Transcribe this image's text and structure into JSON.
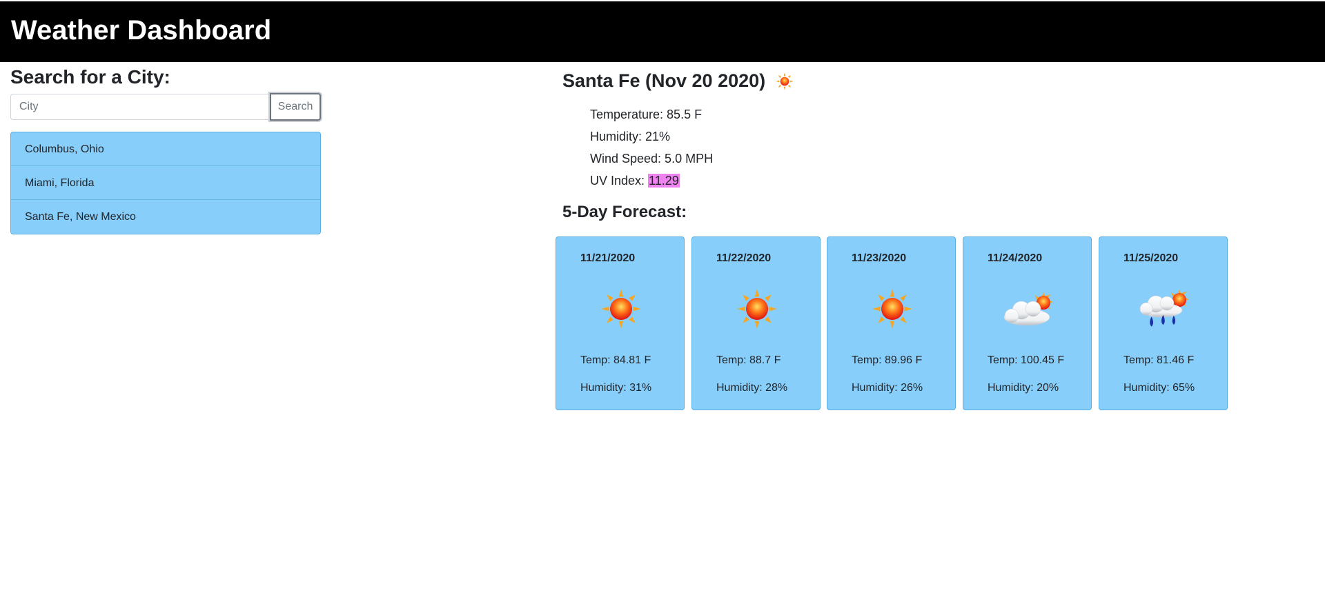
{
  "header": {
    "title": "Weather Dashboard"
  },
  "search": {
    "heading": "Search for a City:",
    "placeholder": "City",
    "button_label": "Search"
  },
  "history": [
    {
      "label": "Columbus, Ohio"
    },
    {
      "label": "Miami, Florida"
    },
    {
      "label": "Santa Fe, New Mexico"
    }
  ],
  "current": {
    "title": "Santa Fe (Nov 20 2020)",
    "icon": "sun-icon",
    "temperature_label": "Temperature: 85.5 F",
    "humidity_label": "Humidity: 21%",
    "wind_label": "Wind Speed: 5.0 MPH",
    "uv_label": "UV Index: ",
    "uv_value": "11.29",
    "uv_color": "#ee82ee"
  },
  "forecast": {
    "heading": "5-Day Forecast:",
    "days": [
      {
        "date": "11/21/2020",
        "icon": "sun-icon",
        "temp": "Temp: 84.81 F",
        "humidity": "Humidity: 31%"
      },
      {
        "date": "11/22/2020",
        "icon": "sun-icon",
        "temp": "Temp: 88.7 F",
        "humidity": "Humidity: 28%"
      },
      {
        "date": "11/23/2020",
        "icon": "sun-icon",
        "temp": "Temp: 89.96 F",
        "humidity": "Humidity: 26%"
      },
      {
        "date": "11/24/2020",
        "icon": "partly-cloudy-icon",
        "temp": "Temp: 100.45 F",
        "humidity": "Humidity: 20%"
      },
      {
        "date": "11/25/2020",
        "icon": "rain-sun-icon",
        "temp": "Temp: 81.46 F",
        "humidity": "Humidity: 65%"
      }
    ]
  },
  "colors": {
    "header_bg": "#000000",
    "card_bg": "#87cefa",
    "uv_highlight": "#ee82ee"
  }
}
